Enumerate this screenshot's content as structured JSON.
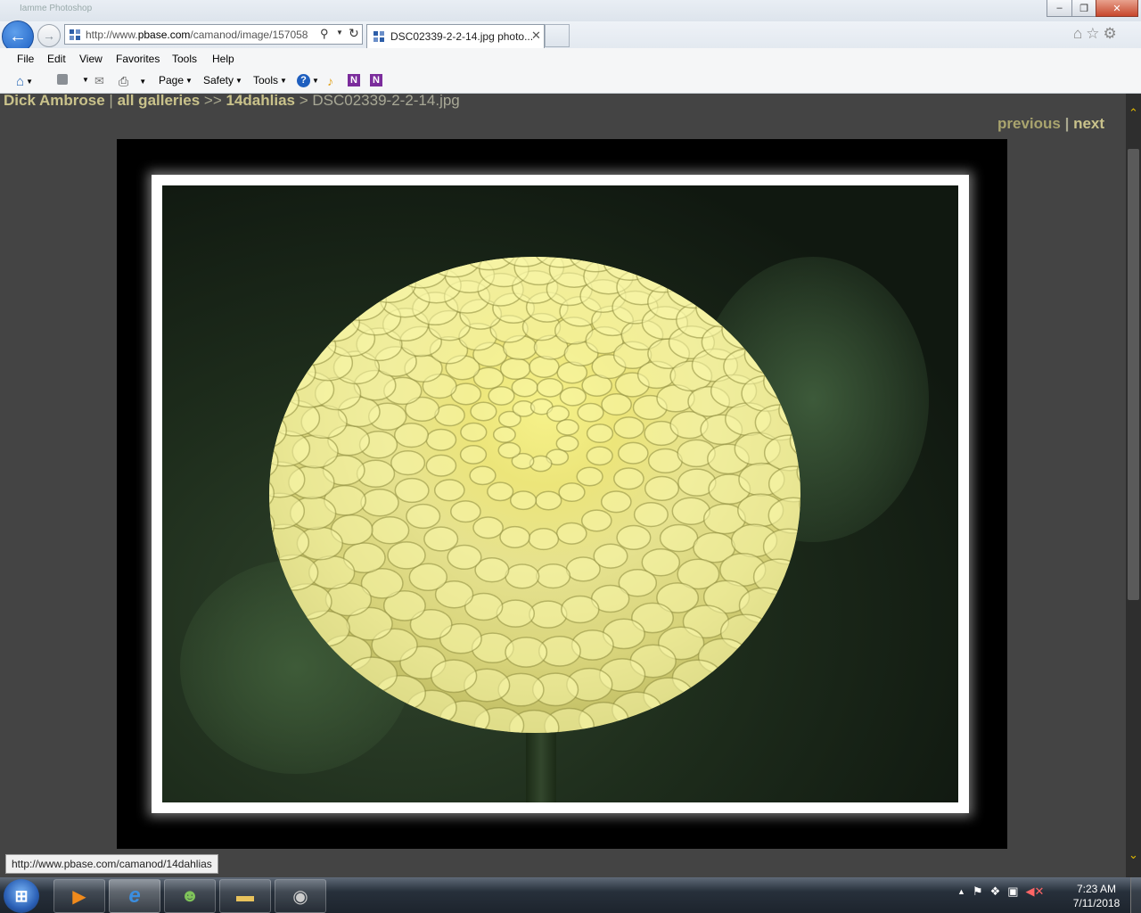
{
  "window": {
    "title": "Iamme Photoshop",
    "controls": {
      "minimize": "–",
      "restore": "❐",
      "close": "✕"
    }
  },
  "nav": {
    "address_prefix": "http://www.",
    "address_domain": "pbase.com",
    "address_rest": "/camanod/image/157058",
    "tab_title": "DSC02339-2-2-14.jpg photo...",
    "back_glyph": "←",
    "forward_glyph": "→"
  },
  "menu": {
    "file": "File",
    "edit": "Edit",
    "view": "View",
    "favorites": "Favorites",
    "tools": "Tools",
    "help": "Help"
  },
  "commandbar": {
    "page": "Page",
    "safety": "Safety",
    "tools": "Tools"
  },
  "breadcrumb": {
    "user": "Dick Ambrose",
    "sep1": " | ",
    "all_galleries": "all galleries",
    "sep2": " >> ",
    "gallery": "14dahlias",
    "sep3": " > ",
    "current": "DSC02339-2-2-14.jpg"
  },
  "pager": {
    "previous": "previous",
    "sep": " | ",
    "next": "next"
  },
  "status_url": "http://www.pbase.com/camanod/14dahlias",
  "taskbar": {
    "clock_time": "7:23 AM",
    "clock_date": "7/11/2018"
  },
  "colors": {
    "link": "#c9c28b",
    "page_bg": "#444444",
    "accent_scroll": "#e0b800"
  }
}
